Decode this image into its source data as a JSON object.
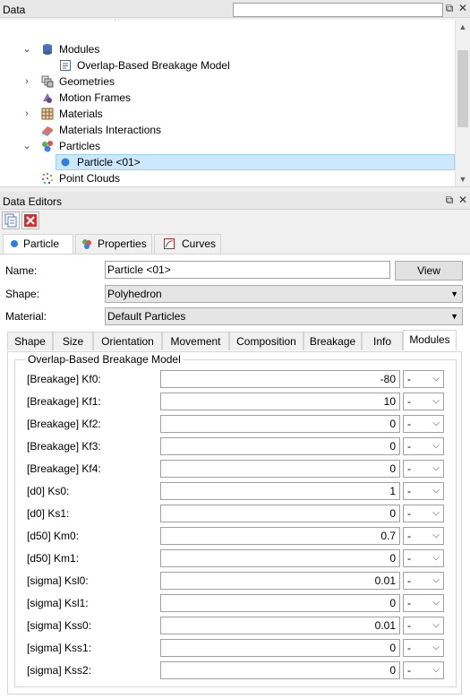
{
  "data_panel": {
    "title": "Data",
    "search_value": "",
    "tree": [
      {
        "label": "Modules",
        "expanded": true,
        "icon": "database-icon"
      },
      {
        "label": "Overlap-Based Breakage Model",
        "icon": "document-icon"
      },
      {
        "label": "Geometries",
        "expanded": false,
        "icon": "geometry-icon"
      },
      {
        "label": "Motion Frames",
        "icon": "motion-icon"
      },
      {
        "label": "Materials",
        "expanded": false,
        "icon": "materials-icon"
      },
      {
        "label": "Materials Interactions",
        "icon": "interactions-icon"
      },
      {
        "label": "Particles",
        "expanded": true,
        "icon": "particles-icon"
      },
      {
        "label": "Particle <01>",
        "icon": "particle-dot-icon",
        "selected": true
      },
      {
        "label": "Point Clouds",
        "icon": "point-cloud-icon"
      }
    ]
  },
  "editors_panel": {
    "title": "Data Editors",
    "tabs": [
      {
        "label": "Particle",
        "active": true
      },
      {
        "label": "Properties",
        "active": false
      },
      {
        "label": "Curves",
        "active": false
      }
    ],
    "name_label": "Name:",
    "name_value": "Particle <01>",
    "view_label": "View",
    "shape_label": "Shape:",
    "shape_value": "Polyhedron",
    "material_label": "Material:",
    "material_value": "Default Particles",
    "sub_tabs": [
      "Shape",
      "Size",
      "Orientation",
      "Movement",
      "Composition",
      "Breakage",
      "Info",
      "Modules"
    ],
    "active_sub_tab": "Modules",
    "group_title": "Overlap-Based Breakage Model",
    "params": [
      {
        "label": "[Breakage] Kf0:",
        "value": "-80",
        "unit": "-"
      },
      {
        "label": "[Breakage] Kf1:",
        "value": "10",
        "unit": "-"
      },
      {
        "label": "[Breakage] Kf2:",
        "value": "0",
        "unit": "-"
      },
      {
        "label": "[Breakage] Kf3:",
        "value": "0",
        "unit": "-"
      },
      {
        "label": "[Breakage] Kf4:",
        "value": "0",
        "unit": "-"
      },
      {
        "label": "[d0] Ks0:",
        "value": "1",
        "unit": "-"
      },
      {
        "label": "[d0] Ks1:",
        "value": "0",
        "unit": "-"
      },
      {
        "label": "[d50] Km0:",
        "value": "0.7",
        "unit": "-"
      },
      {
        "label": "[d50] Km1:",
        "value": "0",
        "unit": "-"
      },
      {
        "label": "[sigma] Ksl0:",
        "value": "0.01",
        "unit": "-"
      },
      {
        "label": "[sigma] Ksl1:",
        "value": "0",
        "unit": "-"
      },
      {
        "label": "[sigma] Kss0:",
        "value": "0.01",
        "unit": "-"
      },
      {
        "label": "[sigma] Kss1:",
        "value": "0",
        "unit": "-"
      },
      {
        "label": "[sigma] Kss2:",
        "value": "0",
        "unit": "-"
      }
    ]
  },
  "colors": {
    "selection": "#cce8ff",
    "selection_border": "#99d1ff",
    "delete_red": "#d83030"
  }
}
